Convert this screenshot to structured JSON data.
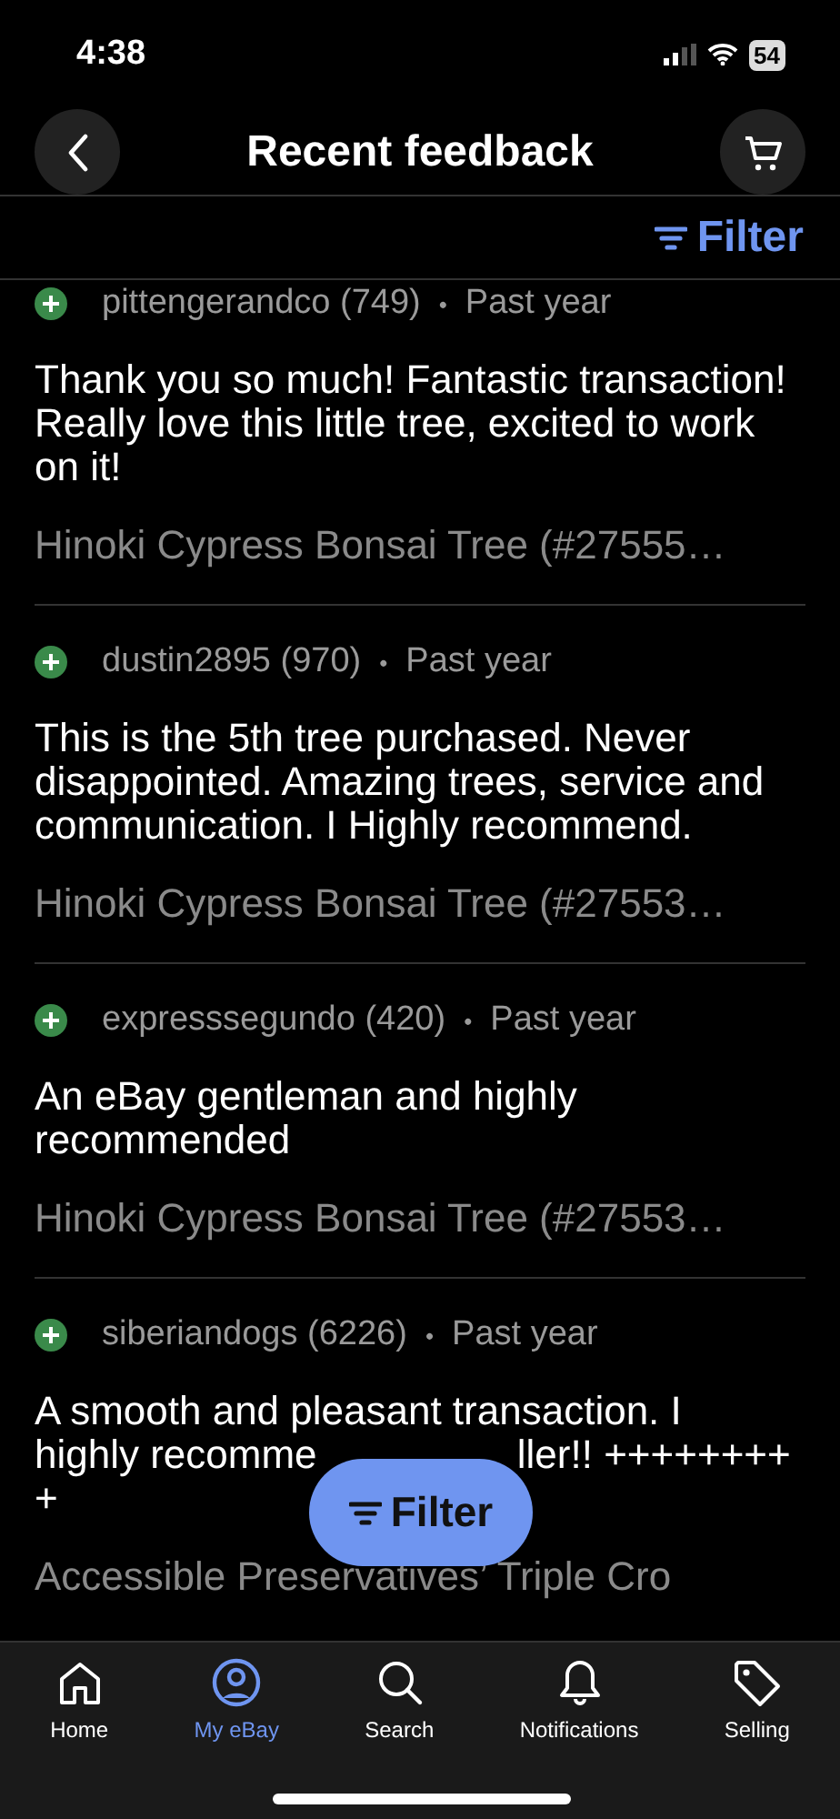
{
  "status_bar": {
    "time": "4:38",
    "battery": "54"
  },
  "header": {
    "title": "Recent feedback"
  },
  "filter_link": {
    "label": "Filter"
  },
  "feedback": [
    {
      "user": "pittengerandco (749)",
      "separator": "•",
      "when": "Past year",
      "comment": "Thank you so much! Fantastic transaction! Really love this little tree, excited to work on it!",
      "item": "Hinoki Cypress Bonsai Tree (#27555…"
    },
    {
      "user": "dustin2895 (970)",
      "separator": "•",
      "when": "Past year",
      "comment": "This is the 5th tree purchased. Never disappointed. Amazing trees, service and communication. I Highly recommend.",
      "item": "Hinoki Cypress Bonsai Tree (#27553…"
    },
    {
      "user": "expresssegundo (420)",
      "separator": "•",
      "when": "Past year",
      "comment": "An eBay gentleman and highly recommended",
      "item": "Hinoki Cypress Bonsai Tree (#27553…"
    },
    {
      "user": "siberiandogs (6226)",
      "separator": "•",
      "when": "Past year",
      "comment_parts": [
        "A smooth and pleasant transaction. I",
        "highly recomme",
        "ller!! ++++++++",
        "+"
      ],
      "item": "Accessible Preservatives’ Triple Cro"
    }
  ],
  "filter_button": {
    "label": "Filter"
  },
  "tab_bar": [
    {
      "label": "Home",
      "selected": false
    },
    {
      "label": "My eBay",
      "selected": true
    },
    {
      "label": "Search",
      "selected": false
    },
    {
      "label": "Notifications",
      "selected": false
    },
    {
      "label": "Selling",
      "selected": false
    }
  ]
}
